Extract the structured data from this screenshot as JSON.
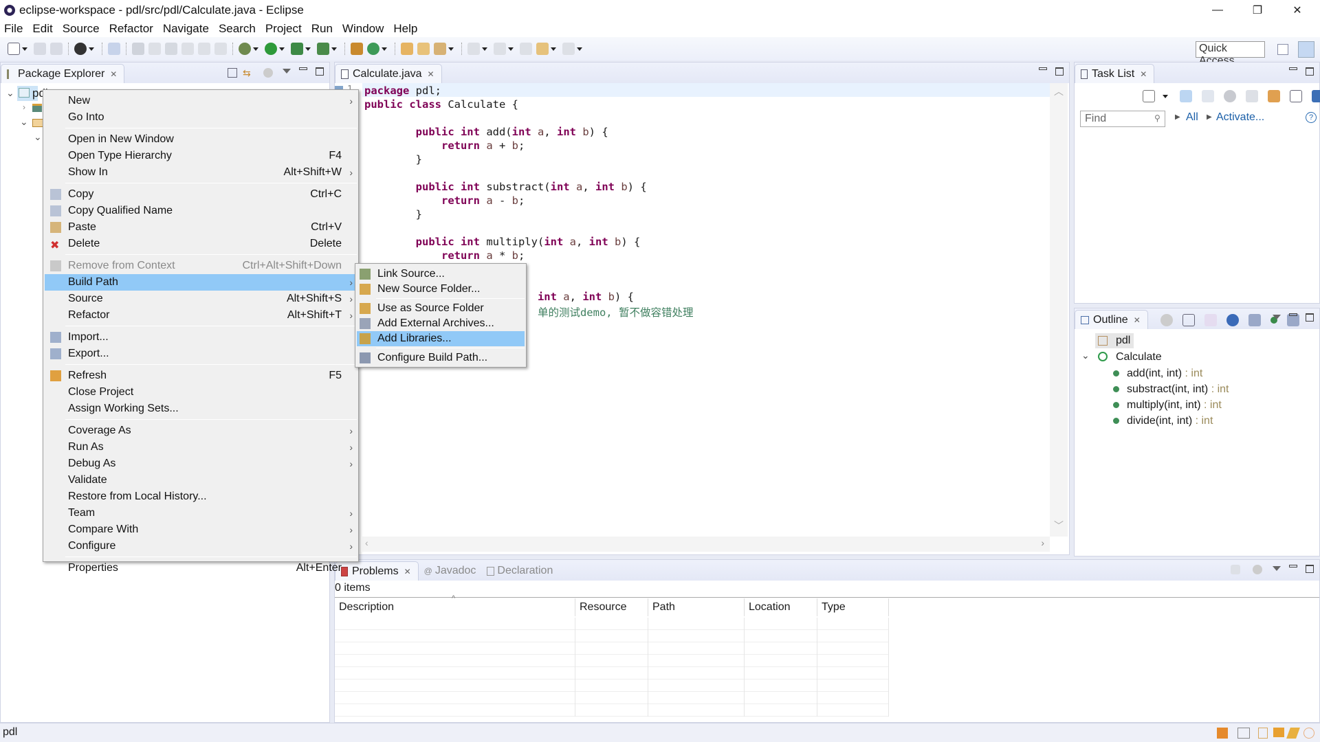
{
  "window": {
    "title": "eclipse-workspace - pdl/src/pdl/Calculate.java - Eclipse",
    "controls": {
      "minimize": "—",
      "restore": "❐",
      "close": "✕"
    }
  },
  "menubar": [
    "File",
    "Edit",
    "Source",
    "Refactor",
    "Navigate",
    "Search",
    "Project",
    "Run",
    "Window",
    "Help"
  ],
  "toolbar": {
    "quick_access": "Quick Access"
  },
  "package_explorer": {
    "tab_label": "Package Explorer",
    "tree": [
      {
        "label": "pdl",
        "icon": "project-folder-icon",
        "expanded": true,
        "selected": true
      },
      {
        "label": "",
        "icon": "library-icon",
        "expanded": false
      },
      {
        "label": "",
        "icon": "src-folder-icon",
        "expanded": true
      },
      {
        "label": "",
        "icon": "package-icon",
        "expanded": true
      }
    ]
  },
  "context_menu": {
    "items": [
      {
        "label": "New",
        "shortcut": "",
        "submenu": true,
        "icon": ""
      },
      {
        "label": "Go Into",
        "shortcut": "",
        "submenu": false,
        "icon": ""
      },
      {
        "separator": true
      },
      {
        "label": "Open in New Window",
        "shortcut": "",
        "submenu": false,
        "icon": ""
      },
      {
        "label": "Open Type Hierarchy",
        "shortcut": "F4",
        "submenu": false,
        "icon": ""
      },
      {
        "label": "Show In",
        "shortcut": "Alt+Shift+W",
        "submenu": true,
        "icon": ""
      },
      {
        "separator": true
      },
      {
        "label": "Copy",
        "shortcut": "Ctrl+C",
        "submenu": false,
        "icon": "copy-icon"
      },
      {
        "label": "Copy Qualified Name",
        "shortcut": "",
        "submenu": false,
        "icon": "copy-qualified-icon"
      },
      {
        "label": "Paste",
        "shortcut": "Ctrl+V",
        "submenu": false,
        "icon": "paste-icon"
      },
      {
        "label": "Delete",
        "shortcut": "Delete",
        "submenu": false,
        "icon": "delete-icon"
      },
      {
        "separator": true
      },
      {
        "label": "Remove from Context",
        "shortcut": "Ctrl+Alt+Shift+Down",
        "submenu": false,
        "icon": "remove-context-icon",
        "disabled": true
      },
      {
        "label": "Build Path",
        "shortcut": "",
        "submenu": true,
        "icon": "",
        "highlighted": true
      },
      {
        "label": "Source",
        "shortcut": "Alt+Shift+S",
        "submenu": true,
        "icon": ""
      },
      {
        "label": "Refactor",
        "shortcut": "Alt+Shift+T",
        "submenu": true,
        "icon": ""
      },
      {
        "separator": true
      },
      {
        "label": "Import...",
        "shortcut": "",
        "submenu": false,
        "icon": "import-icon"
      },
      {
        "label": "Export...",
        "shortcut": "",
        "submenu": false,
        "icon": "export-icon"
      },
      {
        "separator": true
      },
      {
        "label": "Refresh",
        "shortcut": "F5",
        "submenu": false,
        "icon": "refresh-icon"
      },
      {
        "label": "Close Project",
        "shortcut": "",
        "submenu": false,
        "icon": ""
      },
      {
        "label": "Assign Working Sets...",
        "shortcut": "",
        "submenu": false,
        "icon": ""
      },
      {
        "separator": true
      },
      {
        "label": "Coverage As",
        "shortcut": "",
        "submenu": true,
        "icon": ""
      },
      {
        "label": "Run As",
        "shortcut": "",
        "submenu": true,
        "icon": ""
      },
      {
        "label": "Debug As",
        "shortcut": "",
        "submenu": true,
        "icon": ""
      },
      {
        "label": "Validate",
        "shortcut": "",
        "submenu": false,
        "icon": ""
      },
      {
        "label": "Restore from Local History...",
        "shortcut": "",
        "submenu": false,
        "icon": ""
      },
      {
        "label": "Team",
        "shortcut": "",
        "submenu": true,
        "icon": ""
      },
      {
        "label": "Compare With",
        "shortcut": "",
        "submenu": true,
        "icon": ""
      },
      {
        "label": "Configure",
        "shortcut": "",
        "submenu": true,
        "icon": ""
      },
      {
        "separator": true
      },
      {
        "label": "Properties",
        "shortcut": "Alt+Enter",
        "submenu": false,
        "icon": ""
      }
    ]
  },
  "build_path_submenu": {
    "items": [
      {
        "label": "Link Source...",
        "icon": "link-source-icon"
      },
      {
        "label": "New Source Folder...",
        "icon": "new-source-folder-icon"
      },
      {
        "separator": true
      },
      {
        "label": "Use as Source Folder",
        "icon": "use-source-folder-icon"
      },
      {
        "label": "Add External Archives...",
        "icon": "external-archive-icon"
      },
      {
        "label": "Add Libraries...",
        "icon": "library-icon",
        "highlighted": true
      },
      {
        "separator": true
      },
      {
        "label": "Configure Build Path...",
        "icon": "configure-build-path-icon"
      }
    ]
  },
  "editor": {
    "tab_label": "Calculate.java",
    "lines": [
      [
        {
          "t": "package",
          "c": "kw"
        },
        {
          "t": " pdl;",
          "c": ""
        }
      ],
      [
        {
          "t": "public class",
          "c": "kw"
        },
        {
          "t": " Calculate {",
          "c": ""
        }
      ],
      [],
      [
        {
          "t": "        ",
          "c": ""
        },
        {
          "t": "public int",
          "c": "kw"
        },
        {
          "t": " add(",
          "c": ""
        },
        {
          "t": "int",
          "c": "kw"
        },
        {
          "t": " a",
          "c": "var"
        },
        {
          "t": ", ",
          "c": ""
        },
        {
          "t": "int",
          "c": "kw"
        },
        {
          "t": " b",
          "c": "var"
        },
        {
          "t": ") {",
          "c": ""
        }
      ],
      [
        {
          "t": "            ",
          "c": ""
        },
        {
          "t": "return",
          "c": "kw"
        },
        {
          "t": " a",
          "c": "var"
        },
        {
          "t": " + ",
          "c": ""
        },
        {
          "t": "b",
          "c": "var"
        },
        {
          "t": ";",
          "c": ""
        }
      ],
      [
        {
          "t": "        }",
          "c": ""
        }
      ],
      [],
      [
        {
          "t": "        ",
          "c": ""
        },
        {
          "t": "public int",
          "c": "kw"
        },
        {
          "t": " substract(",
          "c": ""
        },
        {
          "t": "int",
          "c": "kw"
        },
        {
          "t": " a",
          "c": "var"
        },
        {
          "t": ", ",
          "c": ""
        },
        {
          "t": "int",
          "c": "kw"
        },
        {
          "t": " b",
          "c": "var"
        },
        {
          "t": ") {",
          "c": ""
        }
      ],
      [
        {
          "t": "            ",
          "c": ""
        },
        {
          "t": "return",
          "c": "kw"
        },
        {
          "t": " a",
          "c": "var"
        },
        {
          "t": " - ",
          "c": ""
        },
        {
          "t": "b",
          "c": "var"
        },
        {
          "t": ";",
          "c": ""
        }
      ],
      [
        {
          "t": "        }",
          "c": ""
        }
      ],
      [],
      [
        {
          "t": "        ",
          "c": ""
        },
        {
          "t": "public int",
          "c": "kw"
        },
        {
          "t": " multiply(",
          "c": ""
        },
        {
          "t": "int",
          "c": "kw"
        },
        {
          "t": " a",
          "c": "var"
        },
        {
          "t": ", ",
          "c": ""
        },
        {
          "t": "int",
          "c": "kw"
        },
        {
          "t": " b",
          "c": "var"
        },
        {
          "t": ") {",
          "c": ""
        }
      ],
      [
        {
          "t": "            ",
          "c": ""
        },
        {
          "t": "return",
          "c": "kw"
        },
        {
          "t": " a",
          "c": "var"
        },
        {
          "t": " * ",
          "c": ""
        },
        {
          "t": "b",
          "c": "var"
        },
        {
          "t": ";",
          "c": ""
        }
      ],
      [],
      [],
      [
        {
          "t": "                           ",
          "c": ""
        },
        {
          "t": "int",
          "c": "kw"
        },
        {
          "t": " a",
          "c": "var"
        },
        {
          "t": ", ",
          "c": ""
        },
        {
          "t": "int",
          "c": "kw"
        },
        {
          "t": " b",
          "c": "var"
        },
        {
          "t": ") {",
          "c": ""
        }
      ],
      [
        {
          "t": "                           ",
          "c": ""
        },
        {
          "t": "单的测试demo, 暂不做容错处理",
          "c": "cm"
        }
      ]
    ],
    "line_number_visible": "1"
  },
  "task_list": {
    "tab_label": "Task List",
    "find_placeholder": "Find",
    "links": [
      "All",
      "Activate..."
    ]
  },
  "outline": {
    "tab_label": "Outline",
    "package": "pdl",
    "class": "Calculate",
    "methods": [
      {
        "sig": "add(int, int)",
        "ret": " : int"
      },
      {
        "sig": "substract(int, int)",
        "ret": " : int"
      },
      {
        "sig": "multiply(int, int)",
        "ret": " : int"
      },
      {
        "sig": "divide(int, int)",
        "ret": " : int"
      }
    ]
  },
  "problems": {
    "tabs": [
      "Problems",
      "Javadoc",
      "Declaration"
    ],
    "count_label": "0 items",
    "columns": [
      "Description",
      "Resource",
      "Path",
      "Location",
      "Type"
    ]
  },
  "statusbar": {
    "text": "pdl"
  },
  "colors": {
    "menu_highlight": "#91c9f7",
    "keyword": "#7f0055",
    "comment": "#3f7f5f",
    "link": "#1b5fa8"
  }
}
